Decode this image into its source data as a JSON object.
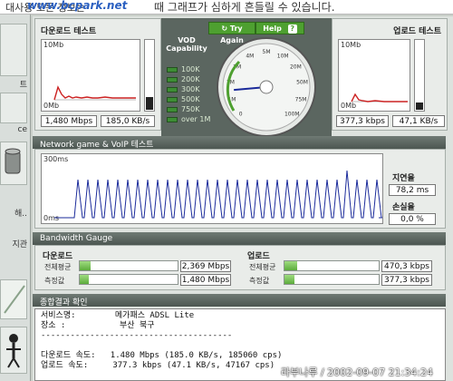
{
  "top_banner": {
    "message_left": "대사용 모든 정보는 ",
    "site": "www.bcpark.net",
    "message_right": "때 그래프가 심하게 흔들릴 수 있습니다."
  },
  "left_nav": {
    "items": [
      "트",
      "ce",
      "해..",
      "지관"
    ]
  },
  "download": {
    "title": "다운로드 테스트",
    "axis_top": "10Mb",
    "axis_bottom": "0Mb",
    "rate_mbps": "1,480 Mbps",
    "rate_kbs": "185,0 KB/s"
  },
  "upload": {
    "title": "업로드 테스트",
    "axis_top": "10Mb",
    "axis_bottom": "0Mb",
    "rate_kbps": "377,3 kbps",
    "rate_kbs": "47,1 KB/s"
  },
  "vod": {
    "title_line1": "VOD",
    "title_line2": "Capability",
    "levels": [
      "100K",
      "200K",
      "300K",
      "500K",
      "750K",
      "over 1M"
    ]
  },
  "gauge": {
    "try_again": "Try Again",
    "help": "Help",
    "help_icon": "?",
    "scale": [
      "0",
      "1M",
      "2M",
      "3M",
      "4M",
      "5M",
      "10M",
      "20M",
      "50M",
      "75M",
      "100M"
    ],
    "needle_value_mbps": 1.48
  },
  "network": {
    "title": "Network game & VoIP 테스트",
    "axis_top": "300ms",
    "axis_bottom": "0ms",
    "latency_label": "지연율",
    "latency_value": "78,2 ms",
    "loss_label": "손실율",
    "loss_value": "0,0 %"
  },
  "bandwidth": {
    "title": "Bandwidth Gauge",
    "download_title": "다운로드",
    "upload_title": "업로드",
    "avg_label": "전체평균",
    "measured_label": "측정값",
    "dl_avg": "2,369 Mbps",
    "dl_measured": "1,480 Mbps",
    "ul_avg": "470,3 kbps",
    "ul_measured": "377,3 kbps",
    "dl_avg_fill": 0.11,
    "dl_measured_fill": 0.09,
    "ul_avg_fill": 0.13,
    "ul_measured_fill": 0.11
  },
  "summary": {
    "title": "종합결과 확인",
    "lines": [
      "서비스명:        메가패스 ADSL Lite",
      "장소 :           부산 북구",
      "---------------------------------------",
      "",
      "다운로드 속도:   1.480 Mbps (185.0 KB/s, 185060 cps)",
      "업로드 속도:     377.3 kbps (47.1 KB/s, 47167 cps)"
    ]
  },
  "watermark": "라부나루 / 2002-09-07 21:34:24",
  "colors": {
    "accent_green": "#4ea030",
    "section_bar": "#5a645f",
    "graph_line_red": "#cc2222",
    "graph_line_blue": "#1a2a9a",
    "bar_green": "#6cbc4c"
  }
}
